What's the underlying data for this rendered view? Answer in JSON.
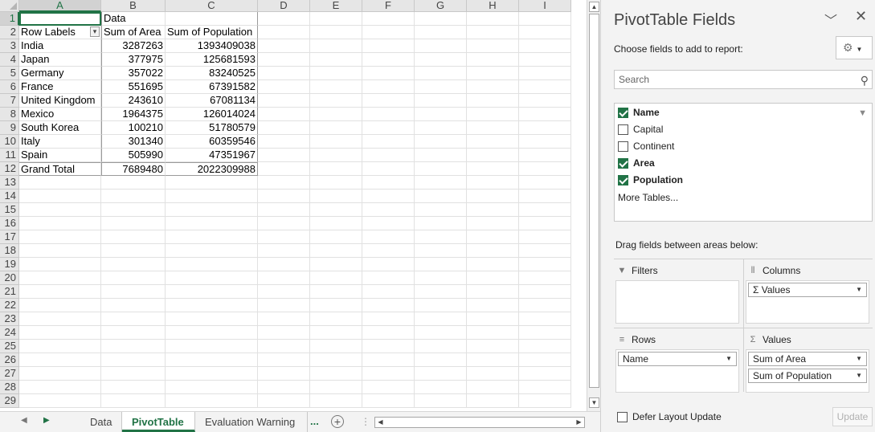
{
  "sheet": {
    "columns": [
      "A",
      "B",
      "C",
      "D",
      "E",
      "F",
      "G",
      "H",
      "I"
    ],
    "active_column": "A",
    "row_numbers": [
      "1",
      "2",
      "3",
      "4",
      "5",
      "6",
      "7",
      "8",
      "9",
      "10",
      "11",
      "12",
      "13",
      "14",
      "15",
      "16",
      "17",
      "18",
      "19",
      "20",
      "21",
      "22",
      "23",
      "24",
      "25",
      "26",
      "27",
      "28",
      "29"
    ],
    "active_row": "1",
    "pivot": {
      "data_header": "Data",
      "row_labels_header": "Row Labels",
      "col_b_header": "Sum of Area",
      "col_c_header": "Sum of Population",
      "rows": [
        {
          "name": "India",
          "area": "3287263",
          "population": "1393409038"
        },
        {
          "name": "Japan",
          "area": "377975",
          "population": "125681593"
        },
        {
          "name": "Germany",
          "area": "357022",
          "population": "83240525"
        },
        {
          "name": "France",
          "area": "551695",
          "population": "67391582"
        },
        {
          "name": "United Kingdom",
          "area": "243610",
          "population": "67081134"
        },
        {
          "name": "Mexico",
          "area": "1964375",
          "population": "126014024"
        },
        {
          "name": "South Korea",
          "area": "100210",
          "population": "51780579"
        },
        {
          "name": "Italy",
          "area": "301340",
          "population": "60359546"
        },
        {
          "name": "Spain",
          "area": "505990",
          "population": "47351967"
        }
      ],
      "grand_total": {
        "name": "Grand Total",
        "area": "7689480",
        "population": "2022309988"
      }
    }
  },
  "tabs": {
    "items": [
      {
        "label": "Data",
        "active": false
      },
      {
        "label": "PivotTable",
        "active": true
      },
      {
        "label": "Evaluation Warning",
        "active": false
      }
    ],
    "more_label": "...",
    "add_label": "+"
  },
  "panel": {
    "title": "PivotTable Fields",
    "choose_label": "Choose fields to add to report:",
    "search_placeholder": "Search",
    "fields": [
      {
        "label": "Name",
        "checked": true
      },
      {
        "label": "Capital",
        "checked": false
      },
      {
        "label": "Continent",
        "checked": false
      },
      {
        "label": "Area",
        "checked": true
      },
      {
        "label": "Population",
        "checked": true
      }
    ],
    "more_tables": "More Tables...",
    "drag_label": "Drag fields between areas below:",
    "areas": {
      "filters": {
        "title": "Filters",
        "items": []
      },
      "columns": {
        "title": "Columns",
        "items": [
          "Σ Values"
        ]
      },
      "rows": {
        "title": "Rows",
        "items": [
          "Name"
        ]
      },
      "values": {
        "title": "Values",
        "items": [
          "Sum of Area",
          "Sum of Population"
        ]
      }
    },
    "defer_label": "Defer Layout Update",
    "update_label": "Update"
  },
  "colors": {
    "accent": "#217346",
    "panel_bg": "#f3f3f3",
    "header_bg": "#e6e6e6"
  }
}
